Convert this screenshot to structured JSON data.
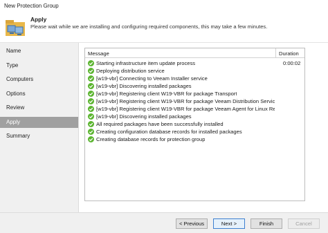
{
  "window": {
    "title": "New Protection Group"
  },
  "header": {
    "title": "Apply",
    "subtitle": "Please wait while we are installing and configuring required components, this may take a few minutes."
  },
  "steps": [
    {
      "label": "Name"
    },
    {
      "label": "Type"
    },
    {
      "label": "Computers"
    },
    {
      "label": "Options"
    },
    {
      "label": "Review"
    },
    {
      "label": "Apply",
      "active": true
    },
    {
      "label": "Summary"
    }
  ],
  "log": {
    "columns": {
      "message": "Message",
      "duration": "Duration"
    },
    "rows": [
      {
        "status": "success",
        "message": "Starting infrastructure item update process",
        "duration": "0:00:02"
      },
      {
        "status": "success",
        "message": "Deploying distribution service",
        "duration": ""
      },
      {
        "status": "success",
        "message": "[w19-vbr] Connecting to Veeam Installer service",
        "duration": ""
      },
      {
        "status": "success",
        "message": "[w19-vbr] Discovering installed packages",
        "duration": ""
      },
      {
        "status": "success",
        "message": "[w19-vbr] Registering client W19-VBR for package Transport",
        "duration": ""
      },
      {
        "status": "success",
        "message": "[w19-vbr] Registering client W19-VBR for package Veeam Distribution Service",
        "duration": ""
      },
      {
        "status": "success",
        "message": "[w19-vbr] Registering client W19-VBR for package Veeam Agent for Linux Re...",
        "duration": ""
      },
      {
        "status": "success",
        "message": "[w19-vbr] Discovering installed packages",
        "duration": ""
      },
      {
        "status": "success",
        "message": "All required packages have been successfully installed",
        "duration": ""
      },
      {
        "status": "success",
        "message": "Creating configuration database records for installed packages",
        "duration": ""
      },
      {
        "status": "success",
        "message": "Creating database records for protection group",
        "duration": ""
      }
    ]
  },
  "buttons": {
    "previous": "< Previous",
    "next": "Next >",
    "finish": "Finish",
    "cancel": "Cancel"
  },
  "colors": {
    "success": "#5cb531",
    "active_step": "#a0a0a0",
    "focus_border": "#3c7fd0"
  }
}
